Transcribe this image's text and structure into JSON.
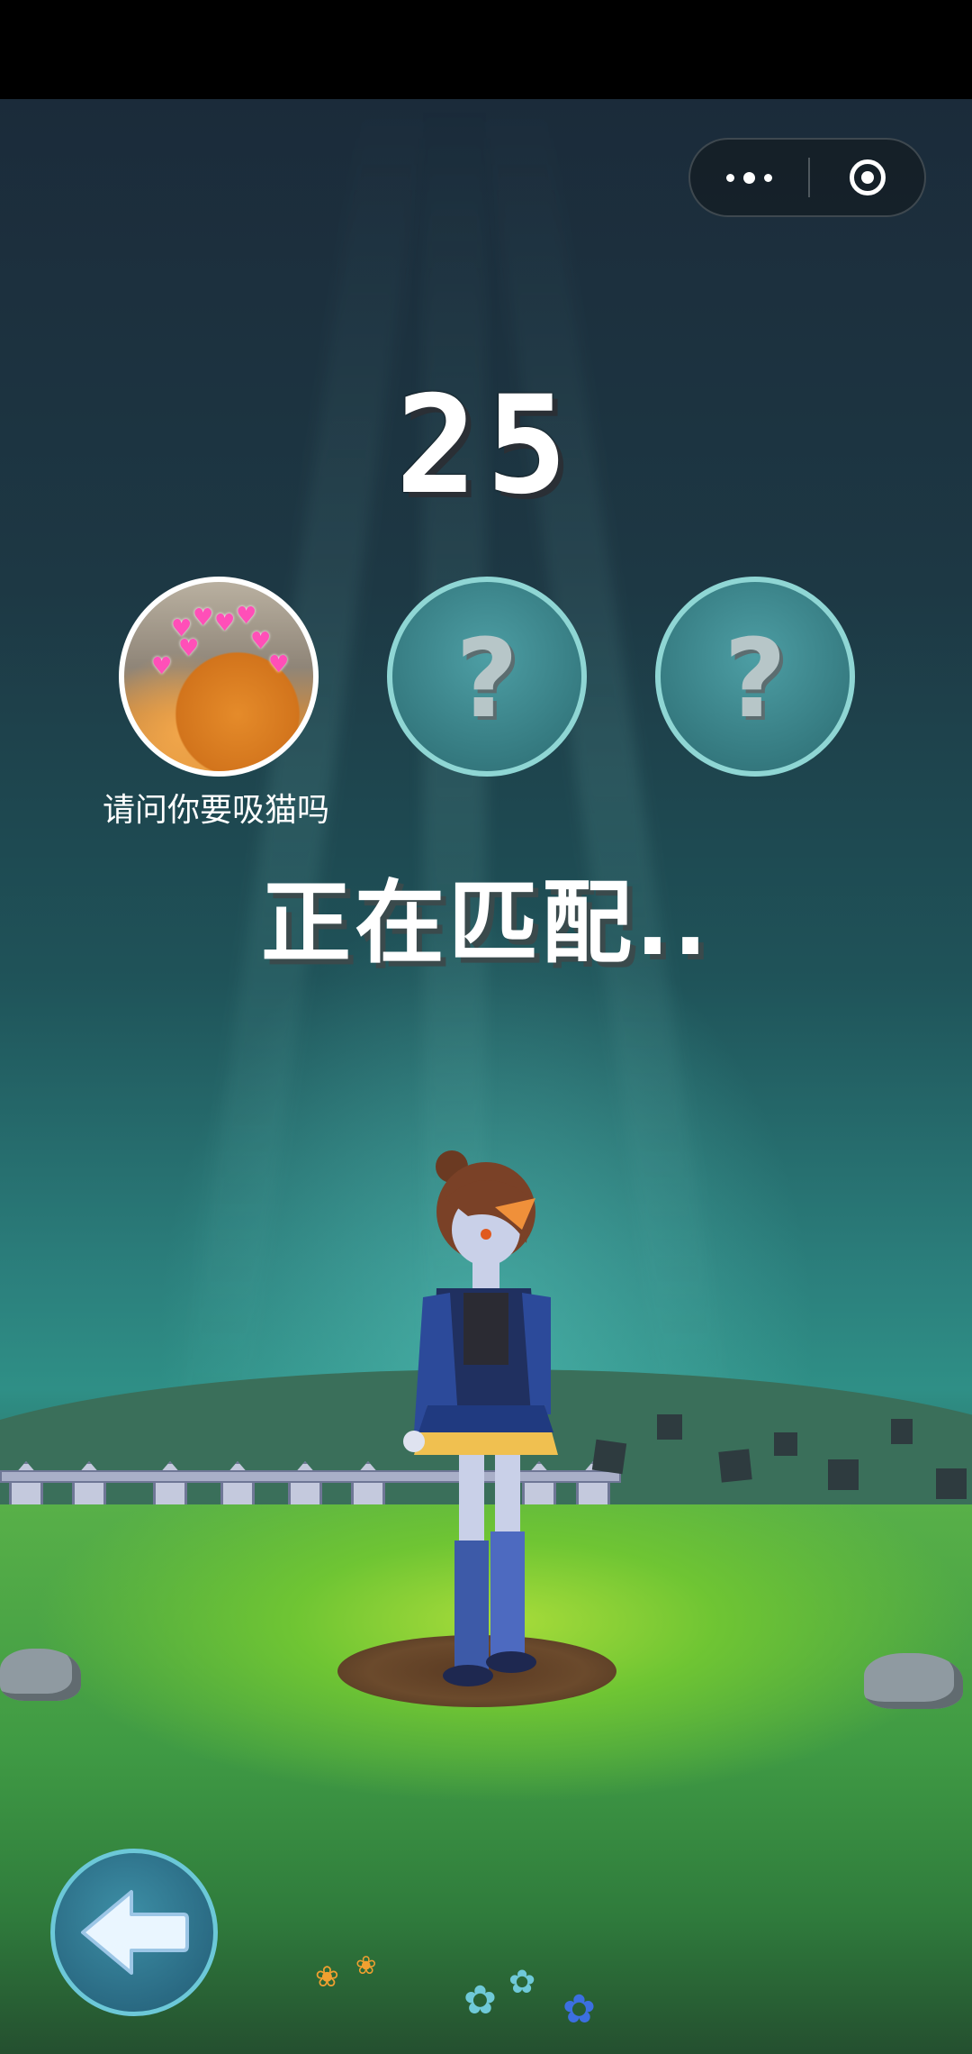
{
  "countdown": "25",
  "players": [
    {
      "name": "请问你要吸猫吗",
      "avatar": "cat-photo-with-hearts"
    },
    {
      "placeholder": "?"
    },
    {
      "placeholder": "?"
    }
  ],
  "status_text": "正在匹配..",
  "capsule": {
    "more_icon": "more-dots-icon",
    "close_icon": "close-target-icon"
  },
  "back_icon": "back-arrow-icon",
  "colors": {
    "accent": "#8fd6d4",
    "text": "#ffffff",
    "back_button": "#2a6a83"
  }
}
